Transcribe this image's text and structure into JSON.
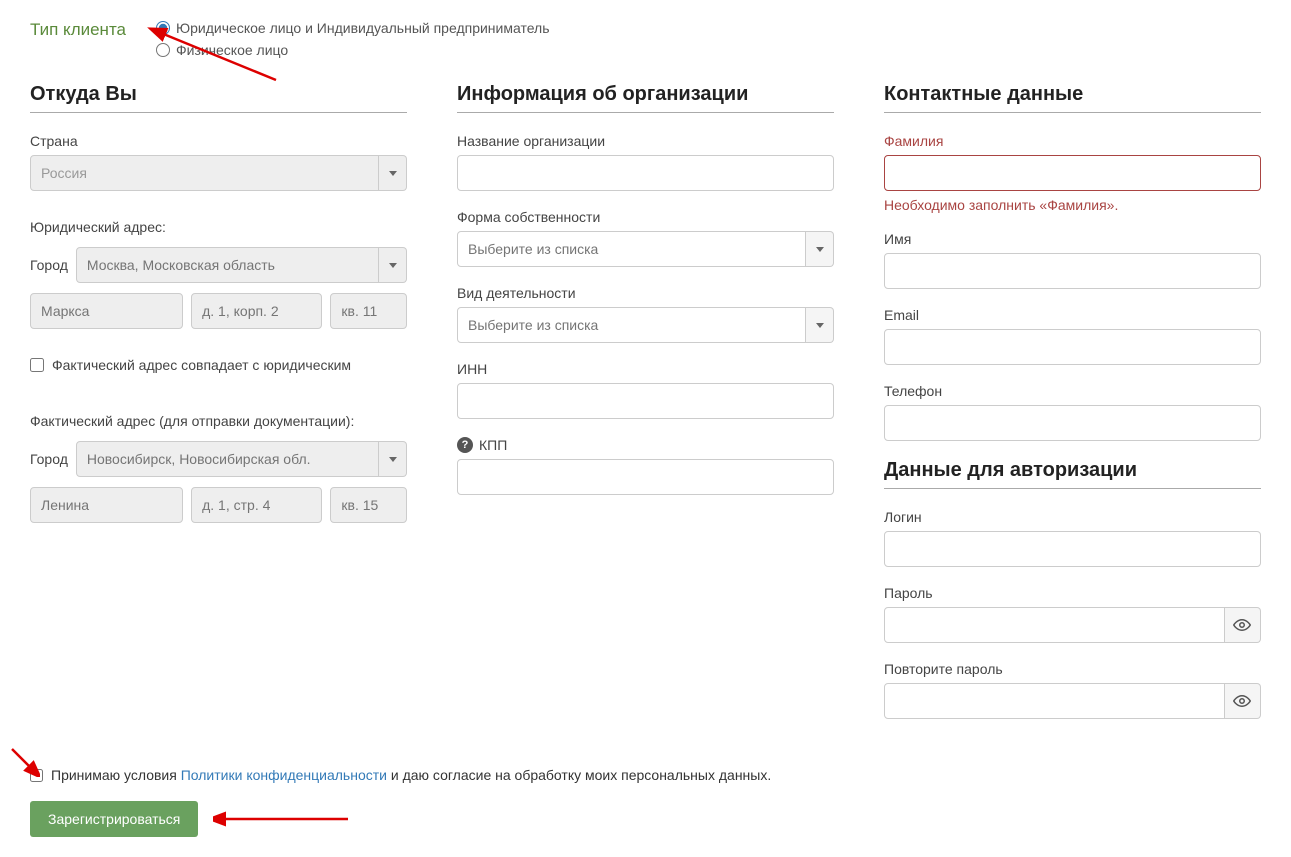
{
  "clientType": {
    "label": "Тип клиента",
    "option1": "Юридическое лицо и Индивидуальный предприниматель",
    "option2": "Физическое лицо"
  },
  "location": {
    "title": "Откуда Вы",
    "countryLabel": "Страна",
    "countryValue": "Россия",
    "legalAddressLabel": "Юридический адрес:",
    "cityLabel": "Город",
    "legalCityPlaceholder": "Москва, Московская область",
    "streetPlaceholder": "Маркса",
    "housePlaceholder": "д. 1, корп. 2",
    "aptPlaceholder": "кв. 11",
    "sameAddressLabel": "Фактический адрес совпадает с юридическим",
    "actualAddressLabel": "Фактический адрес (для отправки документации):",
    "actualCityPlaceholder": "Новосибирск, Новосибирская обл.",
    "actualStreetPlaceholder": "Ленина",
    "actualHousePlaceholder": "д. 1, стр. 4",
    "actualAptPlaceholder": "кв. 15"
  },
  "org": {
    "title": "Информация об организации",
    "nameLabel": "Название организации",
    "ownershipLabel": "Форма собственности",
    "selectPlaceholder": "Выберите из списка",
    "activityLabel": "Вид деятельности",
    "innLabel": "ИНН",
    "kppLabel": "КПП"
  },
  "contact": {
    "title": "Контактные данные",
    "lastnameLabel": "Фамилия",
    "lastnameError": "Необходимо заполнить «Фамилия».",
    "firstnameLabel": "Имя",
    "emailLabel": "Email",
    "phoneLabel": "Телефон"
  },
  "auth": {
    "title": "Данные для авторизации",
    "loginLabel": "Логин",
    "passwordLabel": "Пароль",
    "repeatPasswordLabel": "Повторите пароль"
  },
  "terms": {
    "prefix": "Принимаю условия ",
    "link": "Политики конфиденциальности",
    "suffix": " и даю согласие на обработку моих персональных данных."
  },
  "registerButton": "Зарегистрироваться"
}
